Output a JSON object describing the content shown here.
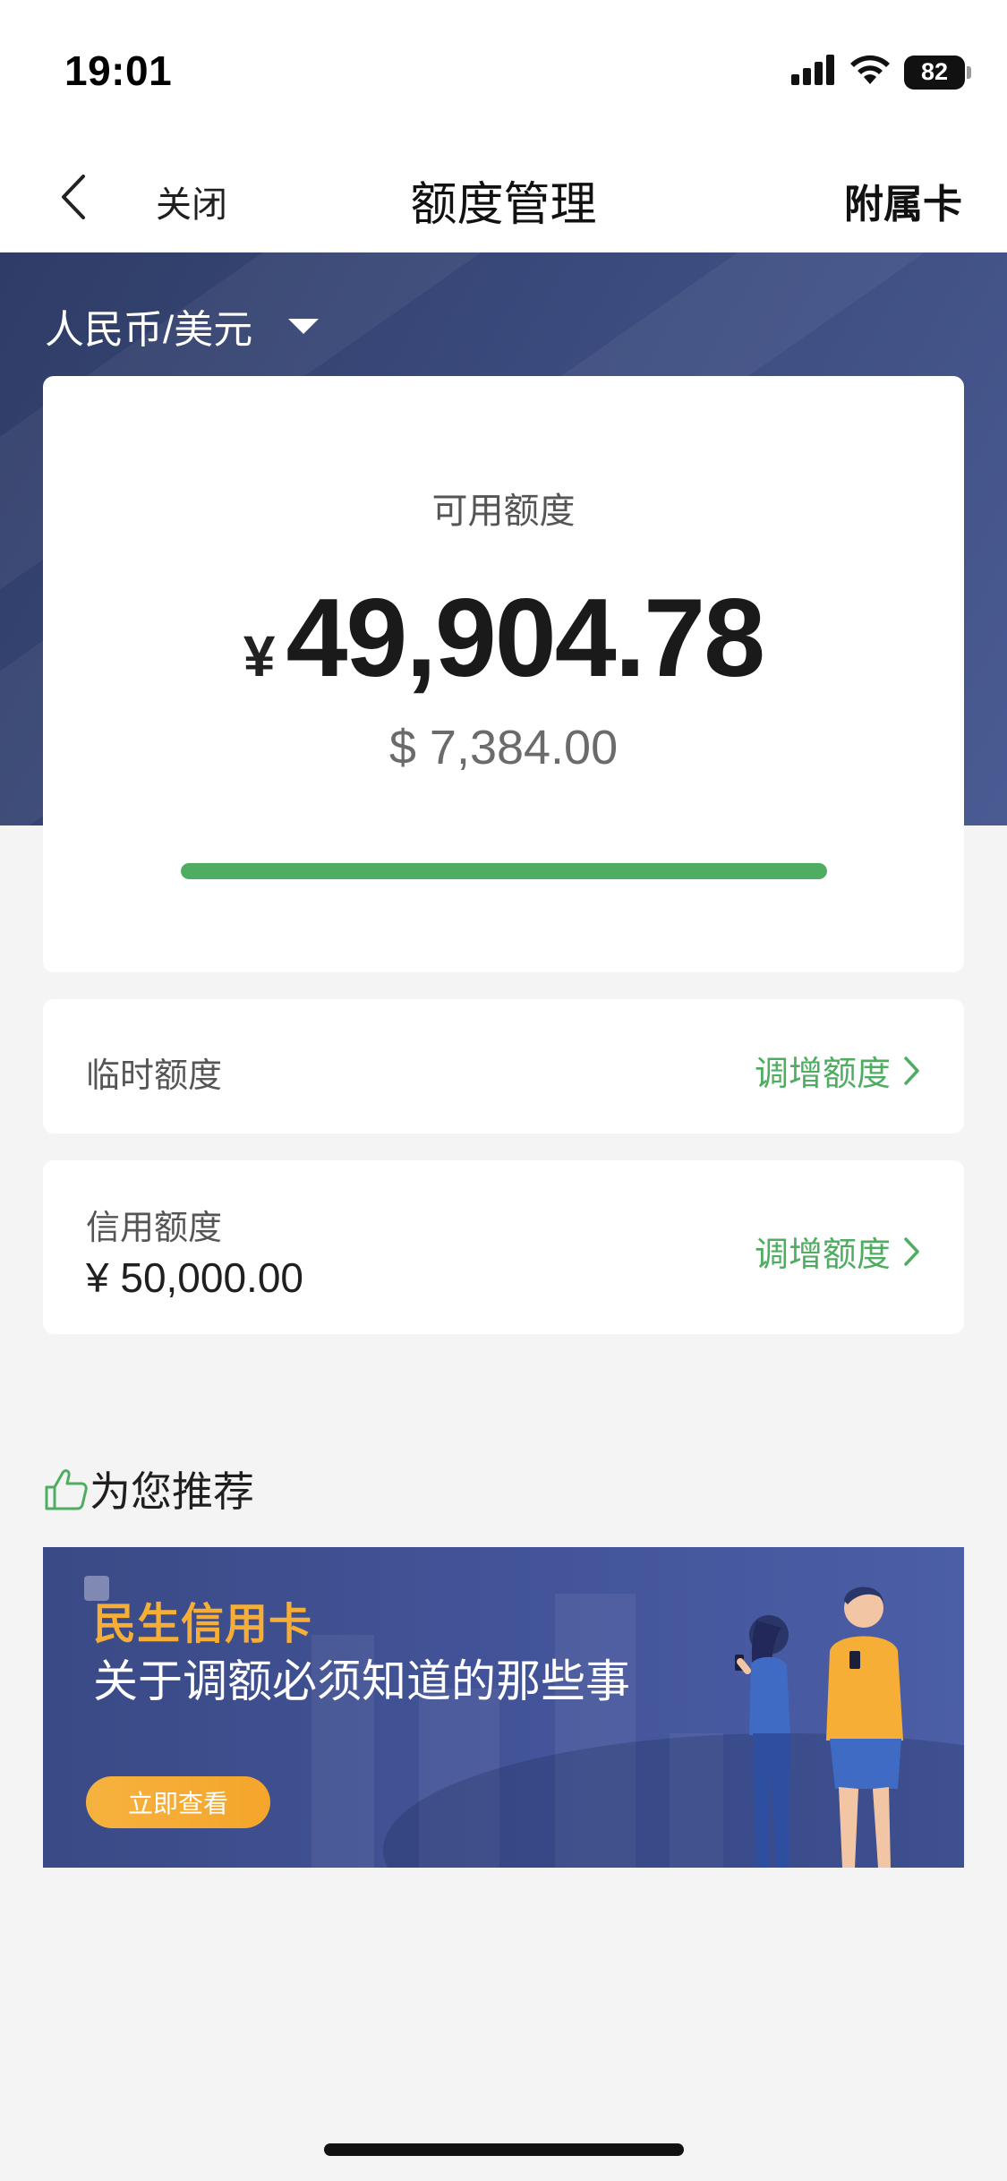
{
  "status_bar": {
    "time": "19:01",
    "battery": "82",
    "icons": [
      "signal-icon",
      "wifi-icon",
      "battery-icon"
    ]
  },
  "nav": {
    "back_icon": "chevron-left-icon",
    "close_label": "关闭",
    "title": "额度管理",
    "right_label": "附属卡"
  },
  "currency_selector": {
    "label": "人民币/美元",
    "icon": "caret-down-icon"
  },
  "available": {
    "label": "可用额度",
    "currency_symbol": "¥",
    "amount": "49,904.78",
    "usd_amount": "$ 7,384.00",
    "progress_fraction": 1.0
  },
  "temporary_limit": {
    "label": "临时额度",
    "action_label": "调增额度"
  },
  "credit_limit": {
    "label": "信用额度",
    "value": "¥ 50,000.00",
    "action_label": "调增额度"
  },
  "recommend": {
    "icon": "thumbs-up-icon",
    "title": "为您推荐",
    "banner": {
      "brand": "民生信用卡",
      "title": "关于调额必须知道的那些事",
      "button_label": "立即查看"
    }
  },
  "colors": {
    "accent_green": "#4fad62",
    "hero_blue": "#3a4a7c",
    "banner_orange": "#f6ae36"
  }
}
